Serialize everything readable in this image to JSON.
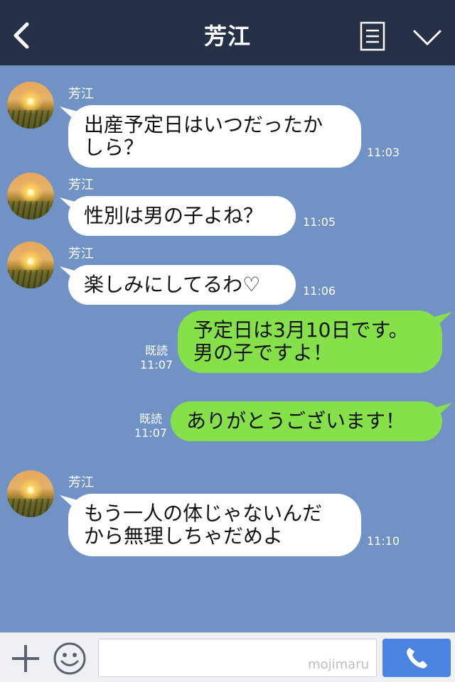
{
  "header": {
    "title": "芳江"
  },
  "messages": [
    {
      "sender": "芳江",
      "line1": "出産予定日はいつだったか",
      "line2": "しら？",
      "time": "11:03"
    },
    {
      "sender": "芳江",
      "text": "性別は男の子よね？",
      "time": "11:05"
    },
    {
      "sender": "芳江",
      "text": "楽しみにしてるわ♡",
      "time": "11:06"
    },
    {
      "line1": "予定日は3月10日です。",
      "line2": "男の子ですよ！",
      "read": "既読",
      "time": "11:07"
    },
    {
      "text": "ありがとうございます！",
      "read": "既読",
      "time": "11:07"
    },
    {
      "sender": "芳江",
      "line1": "もう一人の体じゃないんだ",
      "line2": "から無理しちゃだめよ",
      "time": "11:10"
    }
  ],
  "footer": {
    "input_value": "",
    "watermark": "mojimaru"
  },
  "colors": {
    "header_bg": "#263046",
    "chat_bg": "#7092c4",
    "outgoing_bubble": "#86e04a",
    "incoming_bubble": "#ffffff",
    "call_button": "#4b84e0"
  }
}
